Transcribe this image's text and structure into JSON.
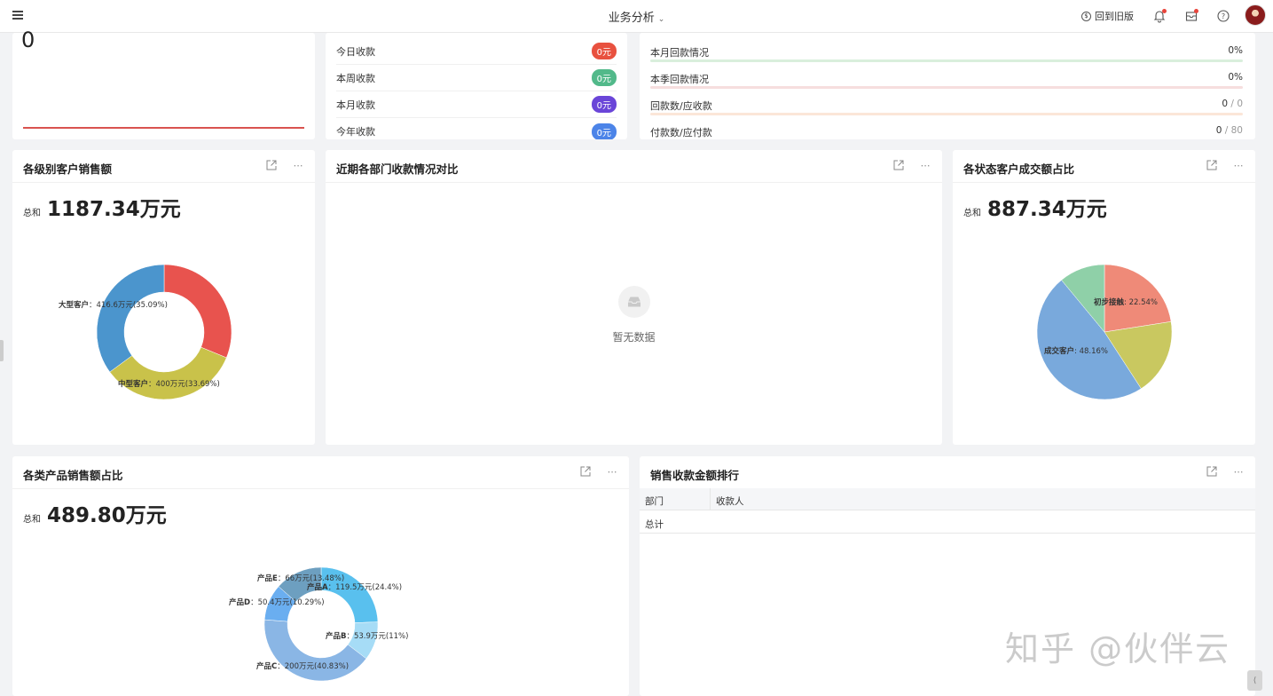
{
  "header": {
    "title": "业务分析",
    "old_version": "回到旧版",
    "old_version_icon": "dollar-circle-icon"
  },
  "top_left": {
    "value": "0"
  },
  "income": {
    "items": [
      {
        "label": "今日收款",
        "value": "0元",
        "color": "#e8513f"
      },
      {
        "label": "本周收款",
        "value": "0元",
        "color": "#52b98a"
      },
      {
        "label": "本月收款",
        "value": "0元",
        "color": "#6a45d8"
      },
      {
        "label": "今年收款",
        "value": "0元",
        "color": "#4c84e8"
      }
    ]
  },
  "payback": {
    "items": [
      {
        "label": "本月回款情况",
        "value": "0%",
        "track": "#d9efdc"
      },
      {
        "label": "本季回款情况",
        "value": "0%",
        "track": "#f6dede"
      },
      {
        "label": "回款数/应收款",
        "value": "0",
        "total": "0",
        "track": "#fbe6d8"
      },
      {
        "label": "付款数/应付款",
        "value": "0",
        "total": "80",
        "track": "#e4ecfa"
      }
    ]
  },
  "customer_level": {
    "title": "各级别客户销售额",
    "total_label": "总和",
    "total_value": "1187.34万元",
    "chart_data": {
      "type": "pie",
      "donut": true,
      "slices": [
        {
          "name": "大型客户",
          "label": "大型客户：416.6万元(35.09%)",
          "percent": 35.09,
          "color": "#4b95cd"
        },
        {
          "name": "中型客户",
          "label": "中型客户：400万元(33.69%)",
          "percent": 33.69,
          "color": "#c9c24a"
        },
        {
          "name": "",
          "label": "",
          "percent": 31.22,
          "color": "#e8534e"
        }
      ]
    }
  },
  "dept_compare": {
    "title": "近期各部门收款情况对比",
    "empty_text": "暂无数据"
  },
  "status_ratio": {
    "title": "各状态客户成交额占比",
    "total_label": "总和",
    "total_value": "887.34万元",
    "chart_data": {
      "type": "pie",
      "slices": [
        {
          "name": "初步接触",
          "label": "初步接触: 22.54%",
          "percent": 22.54,
          "color": "#ef8a78"
        },
        {
          "name": "",
          "label": "",
          "percent": 18.3,
          "color": "#c9c860"
        },
        {
          "name": "成交客户",
          "label": "成交客户: 48.16%",
          "percent": 48.16,
          "color": "#79a9dc"
        },
        {
          "name": "",
          "label": "",
          "percent": 11.0,
          "color": "#8fd0a8"
        }
      ]
    }
  },
  "product_ratio": {
    "title": "各类产品销售额占比",
    "total_label": "总和",
    "total_value": "489.80万元",
    "chart_data": {
      "type": "pie",
      "donut": true,
      "slices": [
        {
          "name": "产品A",
          "label": "产品A：119.5万元(24.4%)",
          "percent": 24.4,
          "color": "#59c0ee"
        },
        {
          "name": "产品B",
          "label": "产品B：53.9万元(11%)",
          "percent": 11.0,
          "color": "#a6dcf6"
        },
        {
          "name": "产品C",
          "label": "产品C：200万元(40.83%)",
          "percent": 40.83,
          "color": "#8ab6e5"
        },
        {
          "name": "产品D",
          "label": "产品D：50.4万元(10.29%)",
          "percent": 10.29,
          "color": "#6aaef0"
        },
        {
          "name": "产品E",
          "label": "产品E：66万元(13.48%)",
          "percent": 13.48,
          "color": "#6d9fc0"
        }
      ]
    }
  },
  "ranking": {
    "title": "销售收款金额排行",
    "columns": [
      "部门",
      "收款人"
    ],
    "total_row": "总计"
  },
  "watermark": "知乎 @伙伴云"
}
